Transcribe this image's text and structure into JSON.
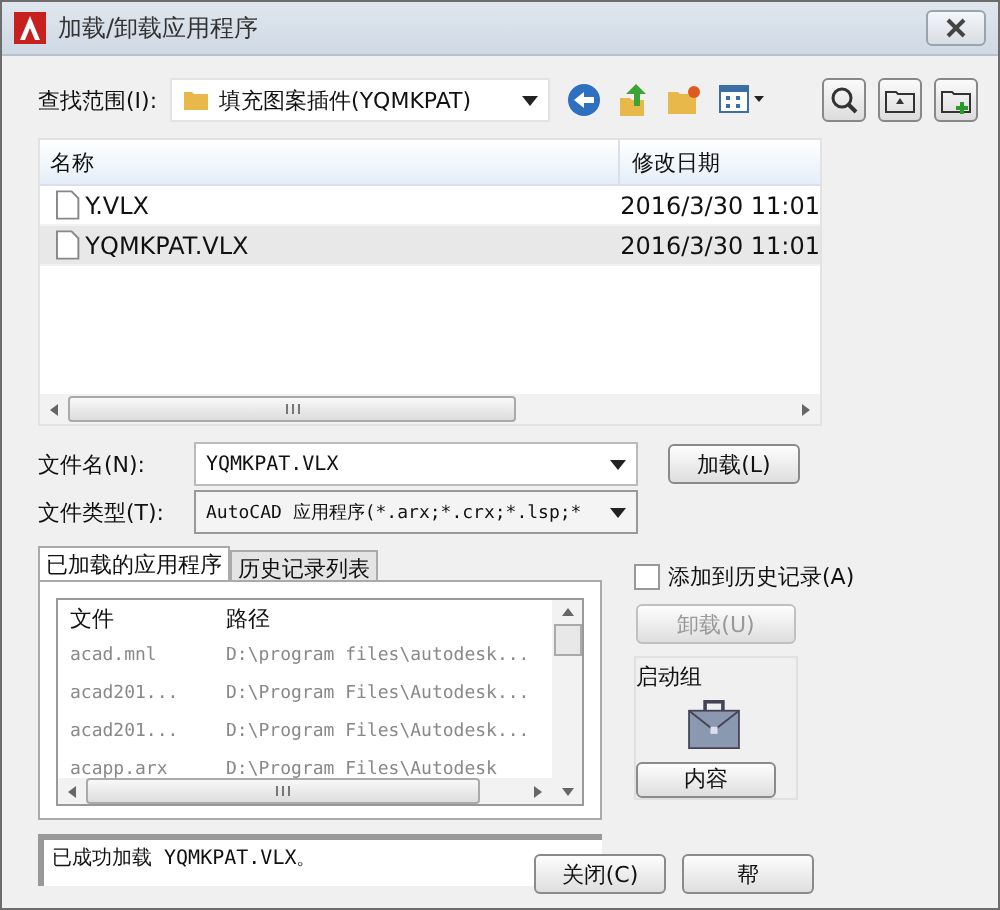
{
  "window": {
    "title": "加载/卸载应用程序"
  },
  "look_in": {
    "label": "查找范围(I):",
    "value": "填充图案插件(YQMKPAT)"
  },
  "file_list": {
    "columns": [
      "名称",
      "修改日期"
    ],
    "rows": [
      {
        "name": "Y.VLX",
        "date": "2016/3/30 11:01",
        "selected": false
      },
      {
        "name": "YQMKPAT.VLX",
        "date": "2016/3/30 11:01",
        "selected": true
      }
    ]
  },
  "file_name": {
    "label": "文件名(N):",
    "value": "YQMKPAT.VLX"
  },
  "file_type": {
    "label": "文件类型(T):",
    "value": "AutoCAD 应用程序(*.arx;*.crx;*.lsp;*"
  },
  "load_button": "加载(L)",
  "tabs": [
    {
      "label": "已加载的应用程序",
      "selected": true
    },
    {
      "label": "历史记录列表",
      "selected": false
    }
  ],
  "loaded_list": {
    "columns": [
      "文件",
      "路径"
    ],
    "rows": [
      {
        "file": "acad.mnl",
        "path": "D:\\program files\\autodesk..."
      },
      {
        "file": "acad201...",
        "path": "D:\\Program Files\\Autodesk..."
      },
      {
        "file": "acad201...",
        "path": "D:\\Program Files\\Autodesk..."
      },
      {
        "file": "acapp.arx",
        "path": "D:\\Program Files\\Autodesk"
      }
    ]
  },
  "add_to_history": {
    "label": "添加到历史记录(A)",
    "checked": false
  },
  "unload_button": {
    "label": "卸载(U)",
    "disabled": true
  },
  "startup_suite": {
    "title": "启动组",
    "contents_button": "内容"
  },
  "status": "已成功加载 YQMKPAT.VLX。",
  "buttons": [
    "关闭(C)",
    "帮"
  ]
}
